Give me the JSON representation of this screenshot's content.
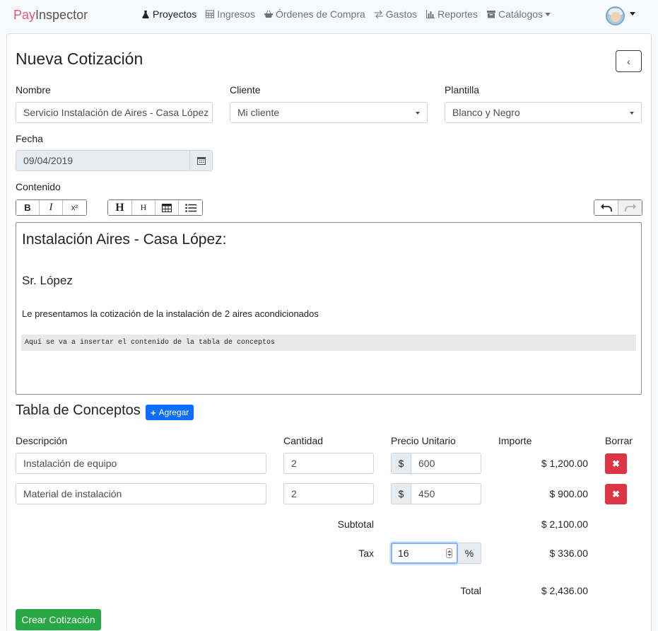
{
  "brand": {
    "pay": "Pay",
    "rest": "Inspector"
  },
  "nav": [
    {
      "label": "Proyectos",
      "icon": "flask-icon",
      "active": true
    },
    {
      "label": "Ingresos",
      "icon": "table-icon"
    },
    {
      "label": "Órdenes de Compra",
      "icon": "shopping-basket-icon"
    },
    {
      "label": "Gastos",
      "icon": "exchange-icon"
    },
    {
      "label": "Reportes",
      "icon": "bar-chart-icon"
    },
    {
      "label": "Catálogos",
      "icon": "archive-icon",
      "dropdown": true
    }
  ],
  "page": {
    "title": "Nueva Cotización",
    "back_icon": "chevron-left-icon"
  },
  "form": {
    "nombre": {
      "label": "Nombre",
      "value": "Servicio Instalación de Aires - Casa López"
    },
    "cliente": {
      "label": "Cliente",
      "value": "Mi cliente"
    },
    "plantilla": {
      "label": "Plantilla",
      "value": "Blanco y Negro"
    },
    "fecha": {
      "label": "Fecha",
      "value": "09/04/2019"
    },
    "contenido": {
      "label": "Contenido"
    }
  },
  "toolbar": {
    "bold": "B",
    "italic": "I",
    "superscript": "x²",
    "h1": "H",
    "h2": "H"
  },
  "editor": {
    "h1": "Instalación Aires - Casa López:",
    "h2": "Sr. López",
    "p": "Le presentamos la cotización de la instalación de 2 aires acondicionados",
    "code": "Aquí se va a insertar el contenido de la tabla de conceptos"
  },
  "conceptos": {
    "title": "Tabla de Conceptos",
    "add_label": "Agregar",
    "headers": {
      "descripcion": "Descripción",
      "cantidad": "Cantidad",
      "precio": "Precio Unitario",
      "importe": "Importe",
      "borrar": "Borrar"
    },
    "currency_symbol": "$",
    "rows": [
      {
        "descripcion": "Instalación de equipo",
        "cantidad": "2",
        "precio": "600",
        "importe": "$ 1,200.00"
      },
      {
        "descripcion": "Material de instalación",
        "cantidad": "2",
        "precio": "450",
        "importe": "$ 900.00"
      }
    ],
    "subtotal_label": "Subtotal",
    "subtotal": "$ 2,100.00",
    "tax_label": "Tax",
    "tax_value": "16",
    "tax_unit": "%",
    "tax_amount": "$ 336.00",
    "total_label": "Total",
    "total": "$ 2,436.00"
  },
  "submit_label": "Crear Cotización",
  "colors": {
    "primary": "#0d6efd",
    "danger": "#dc3545",
    "success": "#28a745",
    "brand_pink": "#e0567a"
  }
}
